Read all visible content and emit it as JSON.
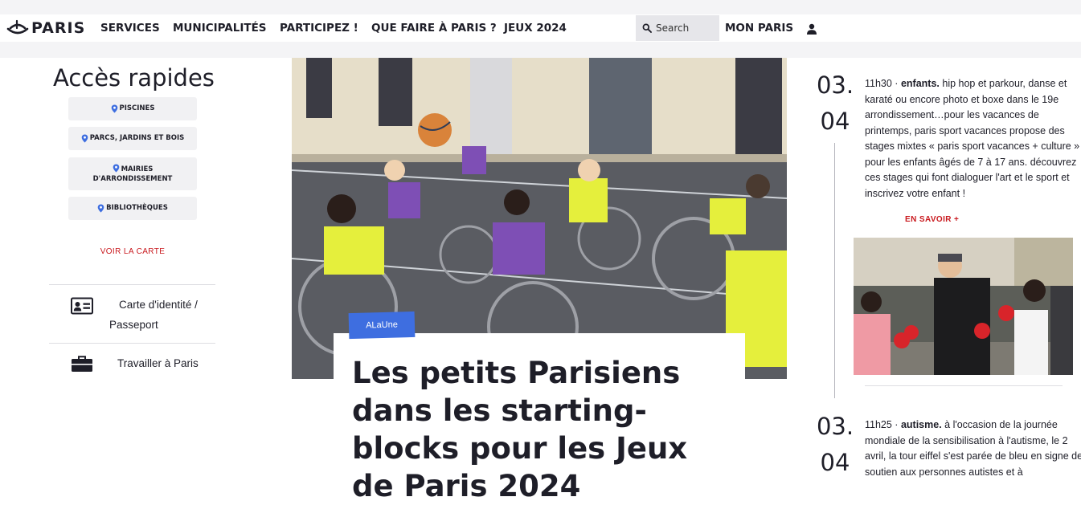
{
  "header": {
    "logo_text": "PARIS",
    "nav": [
      "SERVICES",
      "MUNICIPALITÉS",
      "PARTICIPEZ !",
      "QUE FAIRE À PARIS ?",
      "JEUX 2024"
    ],
    "search_placeholder": "Search",
    "account_label": "MON PARIS",
    "icons": {
      "logo": "paris-ship-logo",
      "search": "search-icon",
      "user": "user-icon"
    }
  },
  "quick_access": {
    "title": "Accès rapides",
    "items": [
      "PISCINES",
      "PARCS, JARDINS ET BOIS",
      "MAIRIES",
      "D'ARRONDISSEMENT",
      "BIBLIOTHÈQUES"
    ],
    "map_link": "VOIR LA CARTE",
    "links": [
      {
        "label": "Carte d'identité /",
        "label2": "Passeport",
        "icon": "id-card-icon"
      },
      {
        "label": "Travailler à Paris",
        "icon": "briefcase-icon"
      }
    ]
  },
  "hero": {
    "tag": "ALaUne",
    "title": "Les petits Parisiens dans les starting-blocks pour les Jeux de Paris 2024"
  },
  "news": [
    {
      "date_day": "03.",
      "date_month": "04",
      "time": "11h30 · ",
      "keyword": "enfants.",
      "text": " hip hop et parkour, danse et karaté ou encore photo et boxe dans le 19e arrondissement…pour les vacances de printemps, paris sport vacances propose des stages mixtes « paris sport vacances + culture » pour les enfants âgés de 7 à 17 ans. découvrez ces stages qui font dialoguer l'art et le sport et inscrivez votre enfant !",
      "more": "EN SAVOIR +"
    },
    {
      "date_day": "03.",
      "date_month": "04",
      "time": "11h25 · ",
      "keyword": "autisme.",
      "text": " à l'occasion de la journée mondiale de la sensibilisation à l'autisme, le 2 avril, la tour eiffel s'est parée de bleu en signe de soutien aux personnes autistes et à"
    }
  ],
  "colors": {
    "accent_red": "#c9191e",
    "tag_blue": "#3e6ee0",
    "text": "#1e1e28"
  }
}
